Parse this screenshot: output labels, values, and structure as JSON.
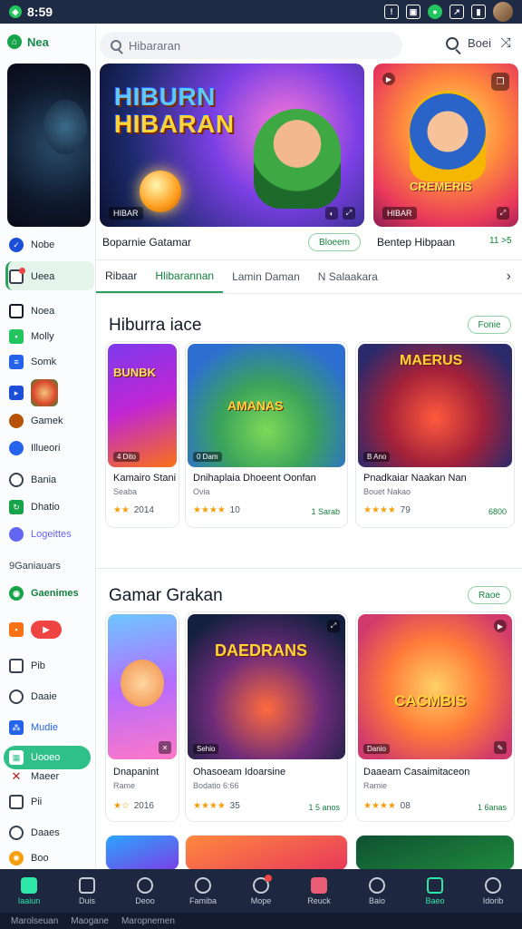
{
  "status_bar": {
    "time": "8:59"
  },
  "sidebar": {
    "home_label": "Nea",
    "items": [
      {
        "label": "Nobe",
        "icon": "shield-icon",
        "color": "#1d4ed8"
      },
      {
        "label": "Ueea",
        "icon": "badge-icon",
        "color": "#ef4444"
      },
      {
        "label": "Noea",
        "icon": "monitor-icon",
        "color": "#111827"
      },
      {
        "label": "Molly",
        "icon": "chat-icon",
        "color": "#22c55e"
      },
      {
        "label": "Somk",
        "icon": "doc-icon",
        "color": "#2563eb"
      },
      {
        "label": "",
        "icon": "flag-icon",
        "color": "#1d4ed8"
      },
      {
        "label": "Gamek",
        "icon": "avatar-icon",
        "color": "#b45309"
      },
      {
        "label": "Illueori",
        "icon": "avatar-icon",
        "color": "#2563eb"
      },
      {
        "label": "Bania",
        "icon": "chat-icon",
        "color": "#374151"
      },
      {
        "label": "Dhatio",
        "icon": "refresh-icon",
        "color": "#16a34a"
      },
      {
        "label": "Logeittes",
        "icon": "people-icon",
        "color": "#6366f1"
      }
    ],
    "section_label": "9Ganiauars",
    "group_label": "Gaenimes",
    "items2": [
      {
        "label": "",
        "icon": "game-icon",
        "color": "#f97316"
      },
      {
        "label": "Pib",
        "icon": "home-icon",
        "color": "#374151"
      },
      {
        "label": "Daaie",
        "icon": "refresh-icon",
        "color": "#374151"
      },
      {
        "label": "Mudie",
        "icon": "network-icon",
        "color": "#2563eb"
      },
      {
        "label": "Uooeo",
        "icon": "grid-icon",
        "color": "#ffffff"
      },
      {
        "label": "Maeer",
        "icon": "close-icon",
        "color": "#b91c1c"
      },
      {
        "label": "Pii",
        "icon": "chart-icon",
        "color": "#374151"
      },
      {
        "label": "Daaes",
        "icon": "dial-icon",
        "color": "#374151"
      },
      {
        "label": "Boo",
        "icon": "sun-icon",
        "color": "#f59e0b"
      }
    ]
  },
  "search": {
    "placeholder": "Hibararan"
  },
  "top_actions": {
    "text": "Boei"
  },
  "hero": {
    "banner_title_line1": "HIBURN",
    "banner_title_line2": "HIBARAN",
    "banner_tag": "HIBAR",
    "banner_caption": "Boparnie Gatamar",
    "banner_button": "Bloeem",
    "side_logo": "CREMERIS",
    "side_tag": "HIBAR",
    "side_caption": "Bentep Hibpaan",
    "side_caption_right": "11 >5"
  },
  "tabs": [
    {
      "label": "Ribaar"
    },
    {
      "label": "Hlibarannan"
    },
    {
      "label": "Lamin Daman"
    },
    {
      "label": "N Salaakara"
    }
  ],
  "section1": {
    "title": "Hiburra iace",
    "more_label": "Fonie",
    "cards": [
      {
        "title": "Kamairo Stani",
        "sub": "Seaba",
        "rating": "2014",
        "right": "",
        "tag": "4 Dito",
        "logo": "BUNBK"
      },
      {
        "title": "Dnihaplaia Dhoeent Oonfan",
        "sub": "Ovia",
        "rating": "10",
        "right": "1 Sarab",
        "tag": "0 Dam",
        "logo": "AMANAS"
      },
      {
        "title": "Pnadkaiar Naakan Nan",
        "sub": "Bouet Nakao",
        "rating": "79",
        "right": "6800",
        "tag": "B Ano",
        "logo": "MAERUS"
      }
    ]
  },
  "section2": {
    "title": "Gamar Grakan",
    "more_label": "Raoe",
    "cards": [
      {
        "title": "Dnapanint",
        "sub": "Rame",
        "rating": "2016",
        "right": "",
        "tag": "",
        "logo": ""
      },
      {
        "title": "Ohasoeam Idoarsine",
        "sub": "Bodatio 6:66",
        "rating": "35",
        "right": "1 5 anos",
        "tag": "Sehio",
        "logo": "DAEDRANS"
      },
      {
        "title": "Daaeam Casaimitaceon",
        "sub": "Ramie",
        "rating": "08",
        "right": "1 6anas",
        "tag": "Danio",
        "logo": "CACMBIS"
      }
    ]
  },
  "bottom_nav": [
    {
      "label": "Iaaiun",
      "active": true
    },
    {
      "label": "Duis",
      "active": false
    },
    {
      "label": "Deoo",
      "active": false
    },
    {
      "label": "Famiba",
      "active": false
    },
    {
      "label": "Mope",
      "active": false,
      "badge": true
    },
    {
      "label": "Reuck",
      "active": false
    },
    {
      "label": "Baio",
      "active": false
    },
    {
      "label": "Baeo",
      "active": true
    },
    {
      "label": "Idorib",
      "active": false
    }
  ],
  "system_bar": [
    {
      "label": "Marolseuan"
    },
    {
      "label": "Maogane"
    },
    {
      "label": "Maropnemen"
    }
  ]
}
